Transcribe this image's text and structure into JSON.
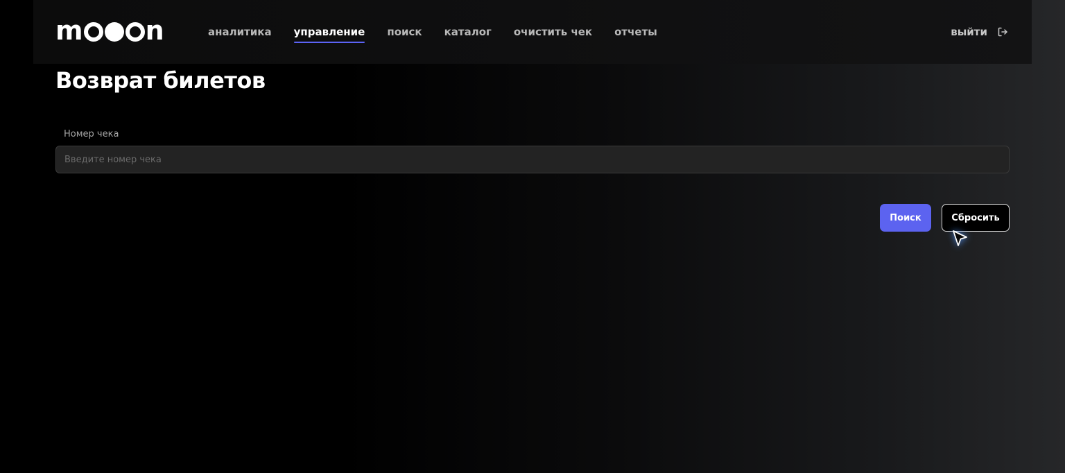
{
  "header": {
    "logo": {
      "letters_before": "m",
      "letters_after": "n",
      "aria_label": "mooon"
    },
    "nav": [
      {
        "label": "аналитика",
        "active": false
      },
      {
        "label": "управление",
        "active": true
      },
      {
        "label": "поиск",
        "active": false
      },
      {
        "label": "каталог",
        "active": false
      },
      {
        "label": "очистить чек",
        "active": false
      },
      {
        "label": "отчеты",
        "active": false
      }
    ],
    "logout_label": "выйти",
    "logout_icon": "logout-icon"
  },
  "page": {
    "title": "Возврат билетов"
  },
  "form": {
    "receipt_label": "Номер чека",
    "receipt_placeholder": "Введите номер чека",
    "receipt_value": ""
  },
  "actions": {
    "search_label": "Поиск",
    "reset_label": "Сбросить"
  },
  "colors": {
    "accent": "#5c63f0",
    "background": "#000000",
    "input_background": "#232323"
  }
}
